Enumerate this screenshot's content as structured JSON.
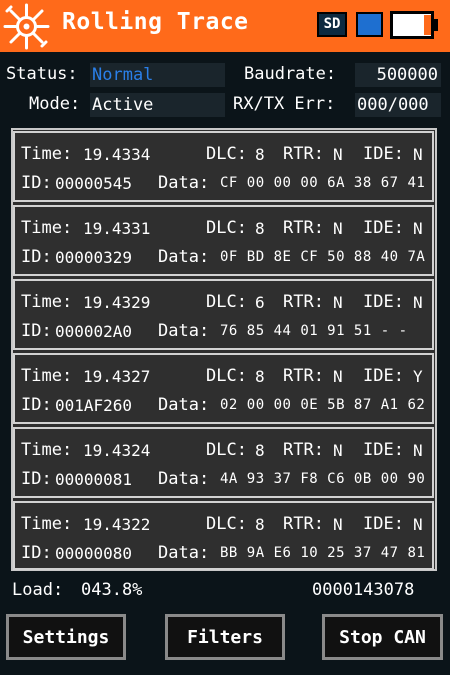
{
  "header": {
    "title": "Rolling Trace",
    "sd_label": "SD",
    "icons": {
      "logo": "circuit-logo-icon",
      "sd": "sd-card-icon",
      "record": "record-icon",
      "battery": "battery-icon"
    },
    "colors": {
      "bar": "#ff6a1a",
      "record": "#1e6fd0",
      "battery_charge": "#ff6a1a"
    },
    "battery_level": 0.85
  },
  "status": {
    "status_label": "Status:",
    "status_value": "Normal",
    "baud_label": "Baudrate:",
    "baud_value": "500000",
    "mode_label": "Mode:",
    "mode_value": "Active",
    "err_label": "RX/TX Err:",
    "err_value": "000/000"
  },
  "labels": {
    "time": "Time:",
    "dlc": "DLC:",
    "rtr": "RTR:",
    "ide": "IDE:",
    "id": "ID:",
    "data": "Data:"
  },
  "frames": [
    {
      "time": "19.4334",
      "dlc": "8",
      "rtr": "N",
      "ide": "N",
      "id": "00000545",
      "data": "CF 00 00 00 6A 38 67 41"
    },
    {
      "time": "19.4331",
      "dlc": "8",
      "rtr": "N",
      "ide": "N",
      "id": "00000329",
      "data": "0F BD 8E CF 50 88 40 7A"
    },
    {
      "time": "19.4329",
      "dlc": "6",
      "rtr": "N",
      "ide": "N",
      "id": "000002A0",
      "data": "76 85 44 01 91 51  -  -"
    },
    {
      "time": "19.4327",
      "dlc": "8",
      "rtr": "N",
      "ide": "Y",
      "id": "001AF260",
      "data": "02 00 00 0E 5B 87 A1 62"
    },
    {
      "time": "19.4324",
      "dlc": "8",
      "rtr": "N",
      "ide": "N",
      "id": "00000081",
      "data": "4A 93 37 F8 C6 0B 00 90"
    },
    {
      "time": "19.4322",
      "dlc": "8",
      "rtr": "N",
      "ide": "N",
      "id": "00000080",
      "data": "BB 9A E6 10 25 37 47 81"
    }
  ],
  "footer": {
    "load_label": "Load:",
    "load_value": "043.8%",
    "frame_count": "0000143078"
  },
  "buttons": {
    "settings": "Settings",
    "filters": "Filters",
    "stop": "Stop CAN"
  }
}
